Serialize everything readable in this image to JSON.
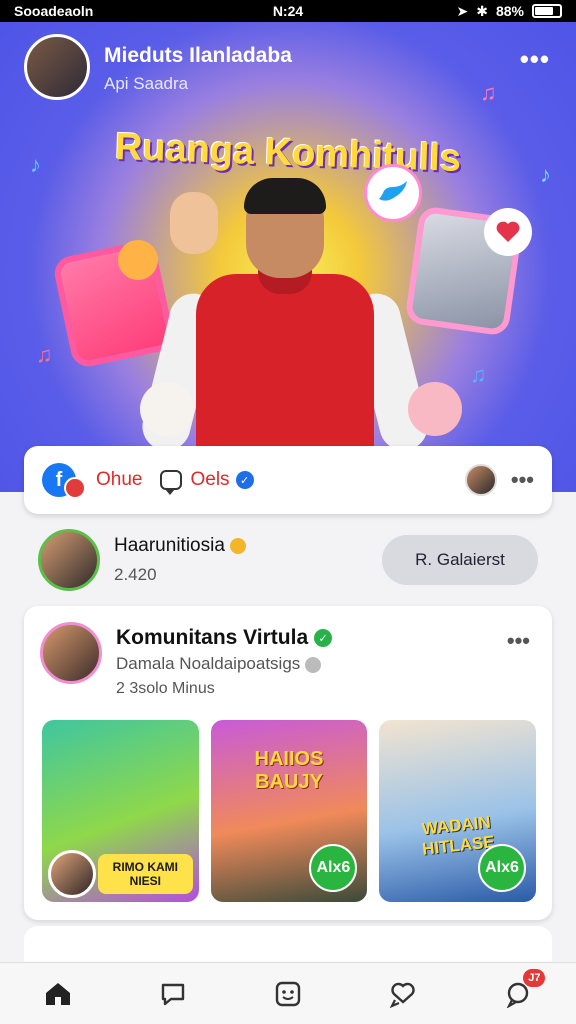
{
  "status_bar": {
    "carrier": "Sooadeaoln",
    "time": "N:24",
    "battery": "88%"
  },
  "hero": {
    "page_name": "Mieduts Ilanladaba",
    "page_sub": "Api Saadra",
    "banner_title": "Ruanga Komhitulls"
  },
  "actions": {
    "label1": "Ohue",
    "label2": "Oels"
  },
  "suggestion": {
    "name": "Haarunitiosia",
    "count": "2.420",
    "button": "R. Galaierst"
  },
  "post": {
    "title": "Komunitans Virtula",
    "subtitle": "Damala Noaldaipoatsigs",
    "meta": "2 3solo Minus",
    "thumb1_caption": "RIMO KAMI\nNIESI",
    "thumb2_caption": "HAIIOS\nBAUJY",
    "thumb3_caption": "WADAIN\nHITLASE",
    "alx_label": "Alx6"
  },
  "nav": {
    "badge": "J7",
    "icons": [
      "home-icon",
      "chat-icon",
      "emoji-icon",
      "heart-chat-icon",
      "chat-badge-icon"
    ]
  },
  "colors": {
    "hero_blue": "#4b52e6",
    "accent_red": "#e02a2a",
    "fb_blue": "#1877f2",
    "green": "#2ab540"
  }
}
